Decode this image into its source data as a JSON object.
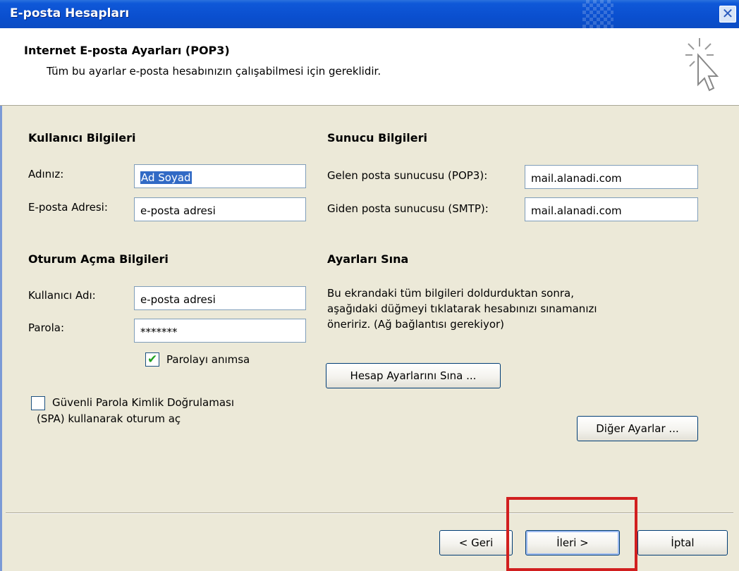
{
  "window": {
    "title": "E-posta Hesapları",
    "close_glyph": "✕"
  },
  "header": {
    "title": "Internet E-posta Ayarları (POP3)",
    "subtitle": "Tüm bu ayarlar e-posta hesabınızın çalışabilmesi için gereklidir.",
    "icon": "wizard-cursor-icon"
  },
  "user_info": {
    "title": "Kullanıcı Bilgileri",
    "name_label": "Adınız:",
    "name_value": "Ad Soyad",
    "email_label": "E-posta Adresi:",
    "email_value": "e-posta adresi"
  },
  "server_info": {
    "title": "Sunucu Bilgileri",
    "incoming_label": "Gelen posta sunucusu (POP3):",
    "incoming_value": "mail.alanadi.com",
    "outgoing_label": "Giden posta sunucusu (SMTP):",
    "outgoing_value": "mail.alanadi.com"
  },
  "logon_info": {
    "title": "Oturum Açma Bilgileri",
    "username_label": "Kullanıcı Adı:",
    "username_value": "e-posta adresi",
    "password_label": "Parola:",
    "password_value": "*******",
    "remember_label": "Parolayı anımsa",
    "remember_checked": true,
    "spa_label_line1": "Güvenli Parola Kimlik Doğrulaması",
    "spa_label_line2": "(SPA) kullanarak oturum aç",
    "spa_checked": false
  },
  "test_settings": {
    "title": "Ayarları Sına",
    "desc_line1": "Bu ekrandaki tüm bilgileri doldurduktan sonra,",
    "desc_line2": "aşağıdaki düğmeyi tıklatarak hesabınızı sınamanızı",
    "desc_line3": "öneririz. (Ağ bağlantısı gerekiyor)",
    "test_button": "Hesap Ayarlarını Sına ...",
    "more_button": "Diğer Ayarlar ..."
  },
  "footer": {
    "back_button": "< Geri",
    "next_button": "İleri >",
    "cancel_button": "İptal",
    "highlight_color": "#d11f1f"
  },
  "colors": {
    "titlebar": "#0a4fcf",
    "dialog_bg": "#ece9d8",
    "selection": "#316ac5"
  }
}
